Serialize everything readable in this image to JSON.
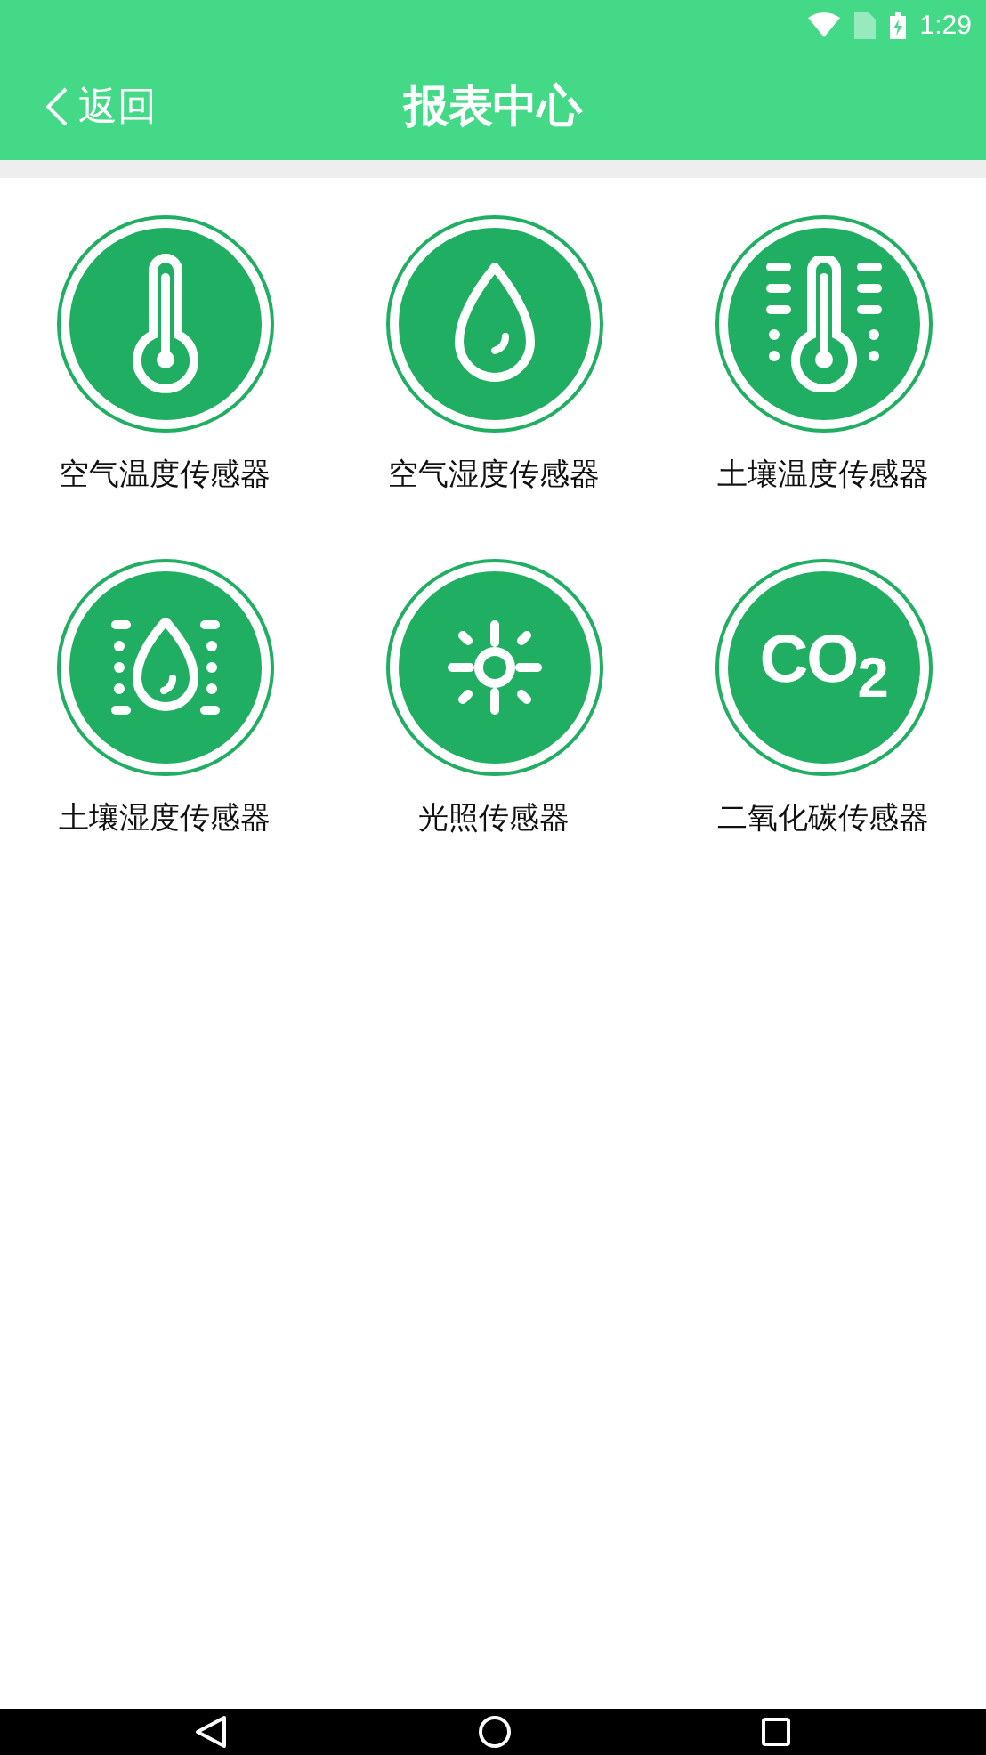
{
  "status_bar": {
    "time": "1:29"
  },
  "header": {
    "back_label": "返回",
    "title": "报表中心"
  },
  "sensors": [
    {
      "kind": "thermometer",
      "label": "空气温度传感器"
    },
    {
      "kind": "drop",
      "label": "空气湿度传感器"
    },
    {
      "kind": "soil-thermometer",
      "label": "土壤温度传感器"
    },
    {
      "kind": "soil-drop",
      "label": "土壤湿度传感器"
    },
    {
      "kind": "sun",
      "label": "光照传感器"
    },
    {
      "kind": "text",
      "icon_text": "CO$_{2}$",
      "label": "二氧化碳传感器"
    }
  ]
}
